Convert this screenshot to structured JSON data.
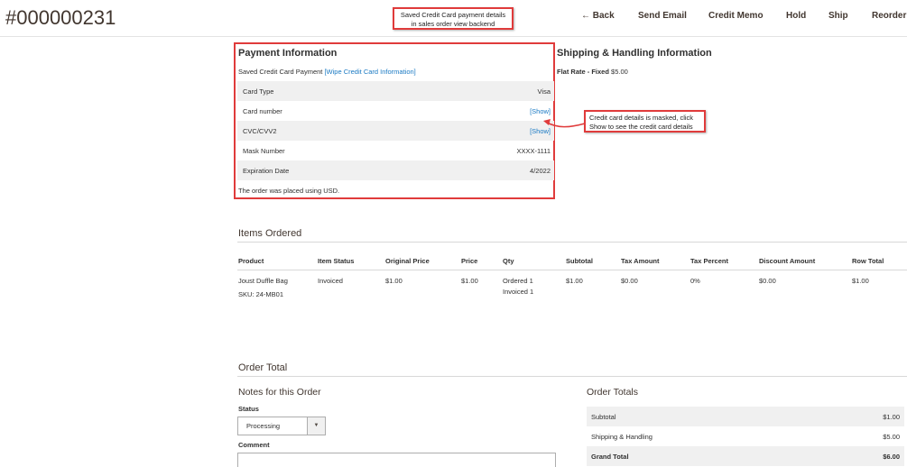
{
  "header": {
    "order_number": "#000000231",
    "actions": [
      "← Back",
      "Send Email",
      "Credit Memo",
      "Hold",
      "Ship",
      "Reorder"
    ]
  },
  "callouts": {
    "top": "Saved Credit Card payment details in sales order view backend",
    "middle": "Credit card details is masked, click Show to see the credit card details"
  },
  "payment": {
    "title": "Payment Information",
    "method_prefix": "Saved  Credit Card Payment ",
    "wipe_link": "[Wipe Credit Card Information]",
    "rows": [
      {
        "label": "Card Type",
        "value": "Visa"
      },
      {
        "label": "Card number",
        "value": "[Show]"
      },
      {
        "label": "CVC/CVV2",
        "value": "[Show]"
      },
      {
        "label": "Mask Number",
        "value": "XXXX-1111"
      },
      {
        "label": "Expiration Date",
        "value": "4/2022"
      }
    ],
    "currency_note": "The order was placed using USD."
  },
  "shipping": {
    "title": "Shipping & Handling Information",
    "method_label": "Flat Rate - Fixed",
    "method_price": "$5.00"
  },
  "items": {
    "title": "Items Ordered",
    "columns": [
      "Product",
      "Item Status",
      "Original Price",
      "Price",
      "Qty",
      "Subtotal",
      "Tax Amount",
      "Tax Percent",
      "Discount Amount",
      "Row Total"
    ],
    "row": {
      "product": "Joust Duffle Bag",
      "sku": "SKU: 24-MB01",
      "status": "Invoiced",
      "original_price": "$1.00",
      "price": "$1.00",
      "qty_ordered": "Ordered 1",
      "qty_invoiced": "Invoiced 1",
      "subtotal": "$1.00",
      "tax_amount": "$0.00",
      "tax_percent": "0%",
      "discount": "$0.00",
      "row_total": "$1.00"
    }
  },
  "order_total": {
    "title": "Order Total",
    "notes_title": "Notes for this Order",
    "status_label": "Status",
    "status_value": "Processing",
    "comment_label": "Comment",
    "totals_title": "Order Totals",
    "totals": [
      {
        "label": "Subtotal",
        "value": "$1.00"
      },
      {
        "label": "Shipping & Handling",
        "value": "$5.00"
      },
      {
        "label": "Grand Total",
        "value": "$6.00"
      }
    ]
  },
  "colors": {
    "accent": "#e03b3b",
    "link": "#1979c3",
    "row_alt": "#f0f0f0"
  }
}
